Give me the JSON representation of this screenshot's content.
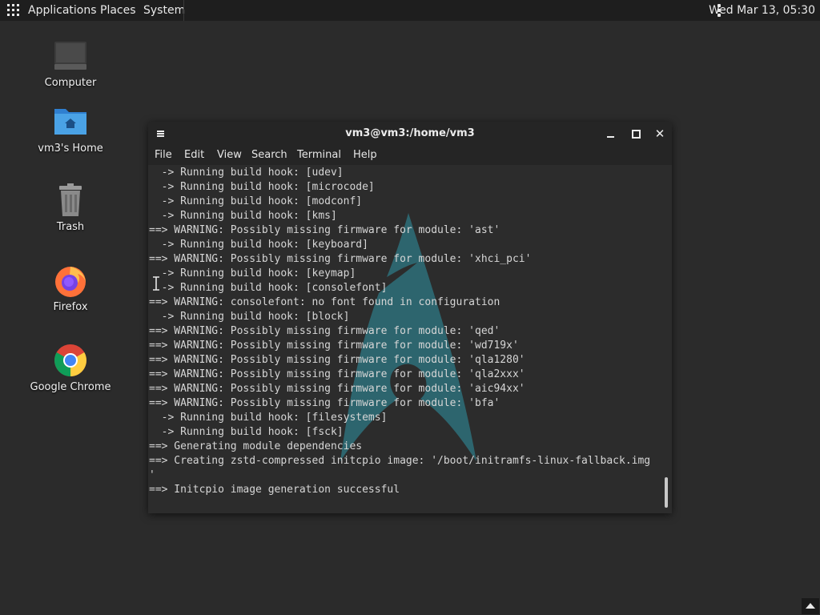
{
  "panel": {
    "menus": [
      "Applications",
      "Places",
      "System"
    ],
    "clock": "Wed Mar 13, 05:30"
  },
  "desktop": {
    "icons": [
      {
        "label": "Computer",
        "icon": "computer-icon"
      },
      {
        "label": "vm3's Home",
        "icon": "home-folder-icon"
      },
      {
        "label": "Trash",
        "icon": "trash-icon"
      },
      {
        "label": "Firefox",
        "icon": "firefox-icon"
      },
      {
        "label": "Google Chrome",
        "icon": "chrome-icon"
      }
    ]
  },
  "terminal": {
    "title": "vm3@vm3:/home/vm3",
    "menu": [
      "File",
      "Edit",
      "View",
      "Search",
      "Terminal",
      "Help"
    ],
    "lines": [
      "  -> Running build hook: [udev]",
      "  -> Running build hook: [microcode]",
      "  -> Running build hook: [modconf]",
      "  -> Running build hook: [kms]",
      "==> WARNING: Possibly missing firmware for module: 'ast'",
      "  -> Running build hook: [keyboard]",
      "==> WARNING: Possibly missing firmware for module: 'xhci_pci'",
      "  -> Running build hook: [keymap]",
      "  -> Running build hook: [consolefont]",
      "==> WARNING: consolefont: no font found in configuration",
      "  -> Running build hook: [block]",
      "==> WARNING: Possibly missing firmware for module: 'qed'",
      "==> WARNING: Possibly missing firmware for module: 'wd719x'",
      "==> WARNING: Possibly missing firmware for module: 'qla1280'",
      "==> WARNING: Possibly missing firmware for module: 'qla2xxx'",
      "==> WARNING: Possibly missing firmware for module: 'aic94xx'",
      "==> WARNING: Possibly missing firmware for module: 'bfa'",
      "  -> Running build hook: [filesystems]",
      "  -> Running build hook: [fsck]",
      "==> Generating module dependencies",
      "==> Creating zstd-compressed initcpio image: '/boot/initramfs-linux-fallback.img",
      "'",
      "==> Initcpio image generation successful"
    ]
  },
  "colors": {
    "desktop_bg": "#2b2b2b",
    "panel_bg": "#1e1e1e",
    "terminal_bg": "#2c2c2c",
    "terminal_fg": "#d6d6d6",
    "arch_logo": "#2e6f7a"
  }
}
